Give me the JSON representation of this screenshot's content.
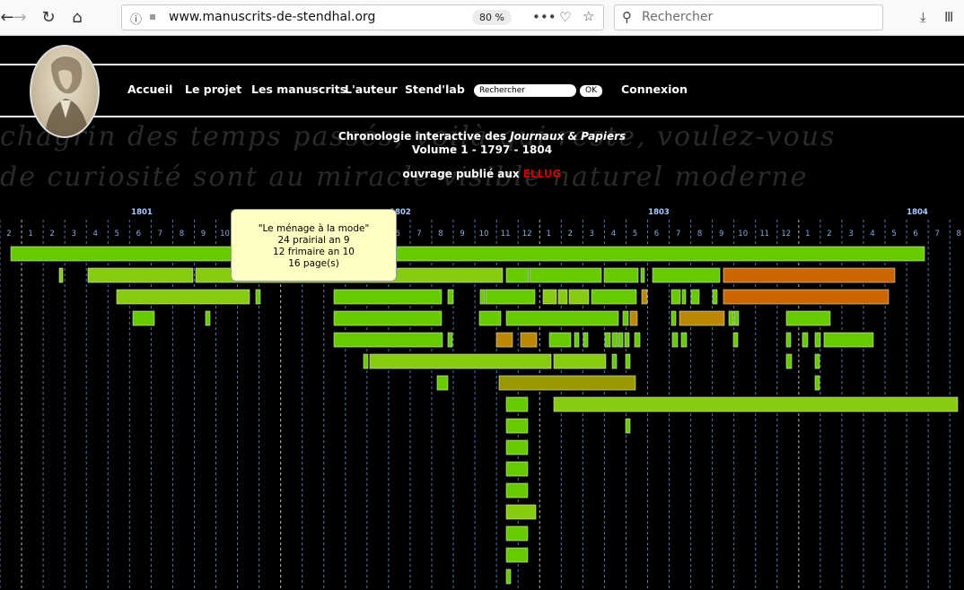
{
  "browser": {
    "url": "www.manuscrits-de-stendhal.org",
    "zoom": "80 %",
    "search_placeholder": "Rechercher",
    "icons": [
      "back-icon",
      "forward-icon",
      "reload-icon",
      "home-icon",
      "info-icon",
      "more-icon",
      "pocket-icon",
      "star-icon",
      "search-icon",
      "download-icon",
      "library-icon"
    ]
  },
  "site": {
    "menu": [
      "Accueil",
      "Le projet",
      "Les manuscrits",
      "L'auteur",
      "Stend'lab"
    ],
    "search_placeholder": "Rechercher",
    "ok_label": "OK",
    "login": "Connexion",
    "title_prefix": "Chronologie interactive des ",
    "title_em": "Journaux & Papiers",
    "volume": "Volume 1 - 1797 - 1804",
    "published_prefix": "ouvrage publié aux ",
    "publisher": "ELLUG",
    "bg_script_1": "chagrin des temps passés, voilà qui reste, voulez-vous",
    "bg_script_2": "de curiosité sont au miracle visible naturel moderne"
  },
  "timeline": {
    "years": [
      {
        "label": "1801",
        "month": 0
      },
      {
        "label": "1802",
        "month": 12
      },
      {
        "label": "1803",
        "month": 24
      },
      {
        "label": "1804",
        "month": 36
      }
    ],
    "month_labels": [
      "2",
      "1",
      "2",
      "3",
      "4",
      "5",
      "6",
      "7",
      "8",
      "9",
      "10",
      "11",
      "12",
      "1",
      "2",
      "3",
      "4",
      "5",
      "6",
      "7",
      "8",
      "9",
      "10",
      "11",
      "12",
      "1",
      "2",
      "3",
      "4",
      "5",
      "6",
      "7",
      "8",
      "9",
      "10",
      "11",
      "12",
      "1",
      "2",
      "3",
      "4",
      "5",
      "6",
      "7",
      "8",
      "9",
      "10",
      "11",
      "12",
      "1",
      "2",
      "3",
      "4",
      "5",
      "6",
      "7",
      "8"
    ],
    "colors": {
      "green": "#66cc00",
      "olive": "#999900",
      "orange": "#cc6600",
      "lime": "#88cc11",
      "amber": "#bb8800"
    },
    "tooltip": {
      "title": "\"Le ménage à la mode\"",
      "line1": "24 prairial an 9",
      "line2": "12 frimaire an 10",
      "line3": "16 page(s)"
    }
  }
}
